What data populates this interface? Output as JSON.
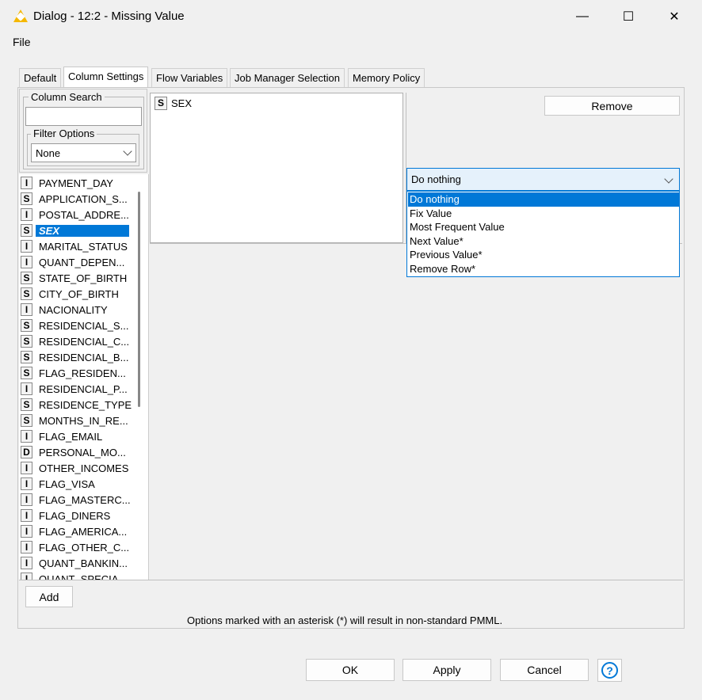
{
  "window": {
    "title": "Dialog - 12:2 - Missing Value",
    "minimize_icon": "—",
    "maximize_icon": "☐",
    "close_icon": "✕"
  },
  "menu": {
    "file": "File"
  },
  "tabs": [
    "Default",
    "Column Settings",
    "Flow Variables",
    "Job Manager Selection",
    "Memory Policy"
  ],
  "column_search": {
    "label": "Column Search",
    "value": ""
  },
  "filter_options": {
    "label": "Filter Options",
    "selected": "None"
  },
  "columns": [
    {
      "type": "I",
      "name": "PAYMENT_DAY"
    },
    {
      "type": "S",
      "name": "APPLICATION_S..."
    },
    {
      "type": "I",
      "name": "POSTAL_ADDRE..."
    },
    {
      "type": "S",
      "name": "SEX"
    },
    {
      "type": "I",
      "name": "MARITAL_STATUS"
    },
    {
      "type": "I",
      "name": "QUANT_DEPEN..."
    },
    {
      "type": "S",
      "name": "STATE_OF_BIRTH"
    },
    {
      "type": "S",
      "name": "CITY_OF_BIRTH"
    },
    {
      "type": "I",
      "name": "NACIONALITY"
    },
    {
      "type": "S",
      "name": "RESIDENCIAL_S..."
    },
    {
      "type": "S",
      "name": "RESIDENCIAL_C..."
    },
    {
      "type": "S",
      "name": "RESIDENCIAL_B..."
    },
    {
      "type": "S",
      "name": "FLAG_RESIDEN..."
    },
    {
      "type": "I",
      "name": "RESIDENCIAL_P..."
    },
    {
      "type": "S",
      "name": "RESIDENCE_TYPE"
    },
    {
      "type": "S",
      "name": "MONTHS_IN_RE..."
    },
    {
      "type": "I",
      "name": "FLAG_EMAIL"
    },
    {
      "type": "D",
      "name": "PERSONAL_MO..."
    },
    {
      "type": "I",
      "name": "OTHER_INCOMES"
    },
    {
      "type": "I",
      "name": "FLAG_VISA"
    },
    {
      "type": "I",
      "name": "FLAG_MASTERC..."
    },
    {
      "type": "I",
      "name": "FLAG_DINERS"
    },
    {
      "type": "I",
      "name": "FLAG_AMERICA..."
    },
    {
      "type": "I",
      "name": "FLAG_OTHER_C..."
    },
    {
      "type": "I",
      "name": "QUANT_BANKIN..."
    },
    {
      "type": "I",
      "name": "QUANT_SPECIA..."
    }
  ],
  "selected_column": {
    "type": "S",
    "name": "SEX"
  },
  "remove_label": "Remove",
  "strategy": {
    "selected": "Do nothing",
    "options": [
      "Do nothing",
      "Fix Value",
      "Most Frequent Value",
      "Next Value*",
      "Previous Value*",
      "Remove Row*"
    ]
  },
  "add_label": "Add",
  "note": "Options marked with an asterisk (*) will result in non-standard PMML.",
  "buttons": {
    "ok": "OK",
    "apply": "Apply",
    "cancel": "Cancel",
    "help_icon": "?"
  },
  "colors": {
    "accent": "#0078d7",
    "warning_icon": "#f5b800"
  }
}
